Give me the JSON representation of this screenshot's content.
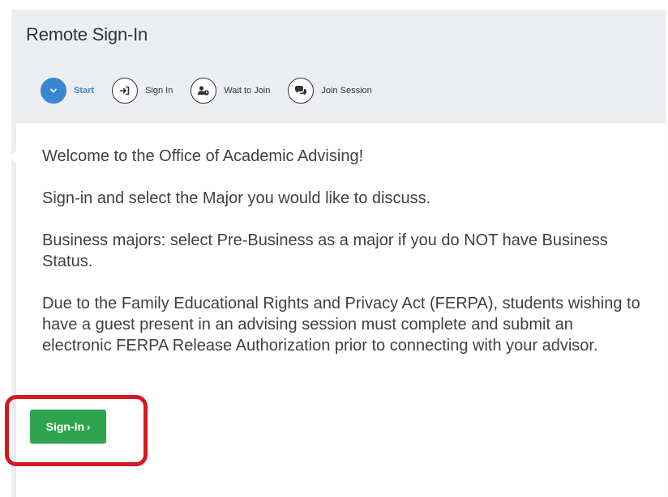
{
  "page": {
    "title": "Remote Sign-In"
  },
  "steps": [
    {
      "label": "Start",
      "icon": "chevron-down-icon",
      "active": true
    },
    {
      "label": "Sign In",
      "icon": "sign-in-icon",
      "active": false
    },
    {
      "label": "Wait to Join",
      "icon": "user-clock-icon",
      "active": false
    },
    {
      "label": "Join Session",
      "icon": "chat-icon",
      "active": false
    }
  ],
  "content": {
    "welcome": "Welcome to the Office of Academic Advising!",
    "instructions": "Sign-in and select the Major you would like to discuss.",
    "business_note": "Business majors: select Pre-Business as a major if you do NOT have Business Status.",
    "ferpa_note": "Due to the Family Educational Rights and Privacy Act (FERPA), students wishing to have a guest present in an advising session must complete and submit an electronic FERPA Release Authorization prior to connecting with your advisor."
  },
  "actions": {
    "signin_label": "Sign-In",
    "signin_chevron": "›"
  },
  "colors": {
    "accent_blue": "#3b86d3",
    "button_green": "#2ea44f",
    "highlight_red": "#d4181f",
    "background": "#eceef1"
  }
}
